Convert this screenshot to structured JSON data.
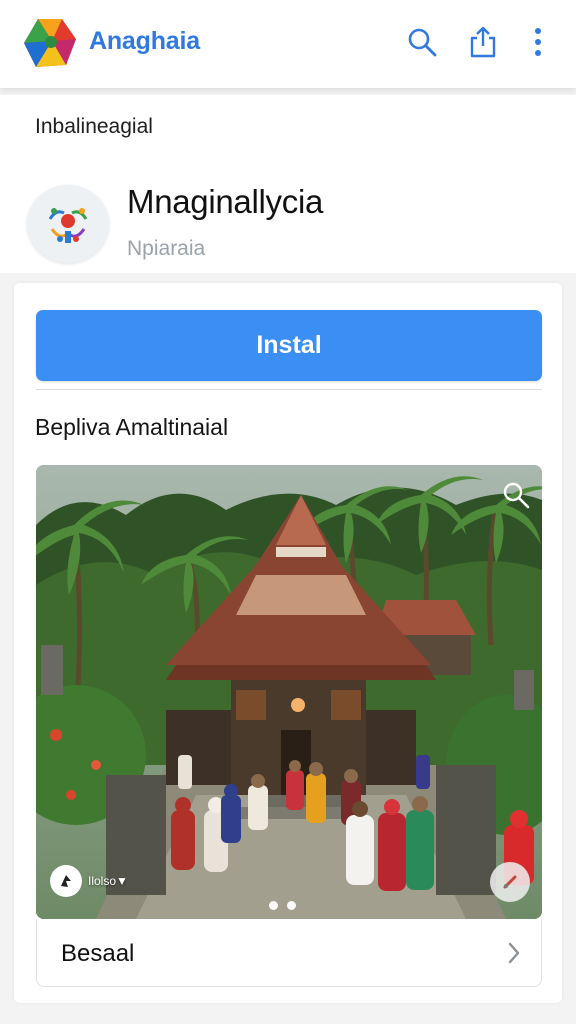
{
  "app_bar": {
    "title": "Anaghaia",
    "icons": [
      "logo-icon",
      "search-icon",
      "share-icon",
      "more-vert-icon"
    ],
    "accent": "#2f79e0"
  },
  "header": {
    "category": "Inbalineagial",
    "app_name": "Mnaginallycia",
    "developer": "Npiaraia"
  },
  "install": {
    "label": "Instal",
    "color": "#3a8ef4"
  },
  "section": {
    "title": "Bepliva Amaltinaial"
  },
  "media": {
    "badge_text": "Ilolso▼",
    "icons": [
      "zoom-icon",
      "badge-icon",
      "edit-icon"
    ],
    "page_count": 2
  },
  "footer": {
    "label": "Besaal",
    "icon": "chevron-right-icon"
  }
}
